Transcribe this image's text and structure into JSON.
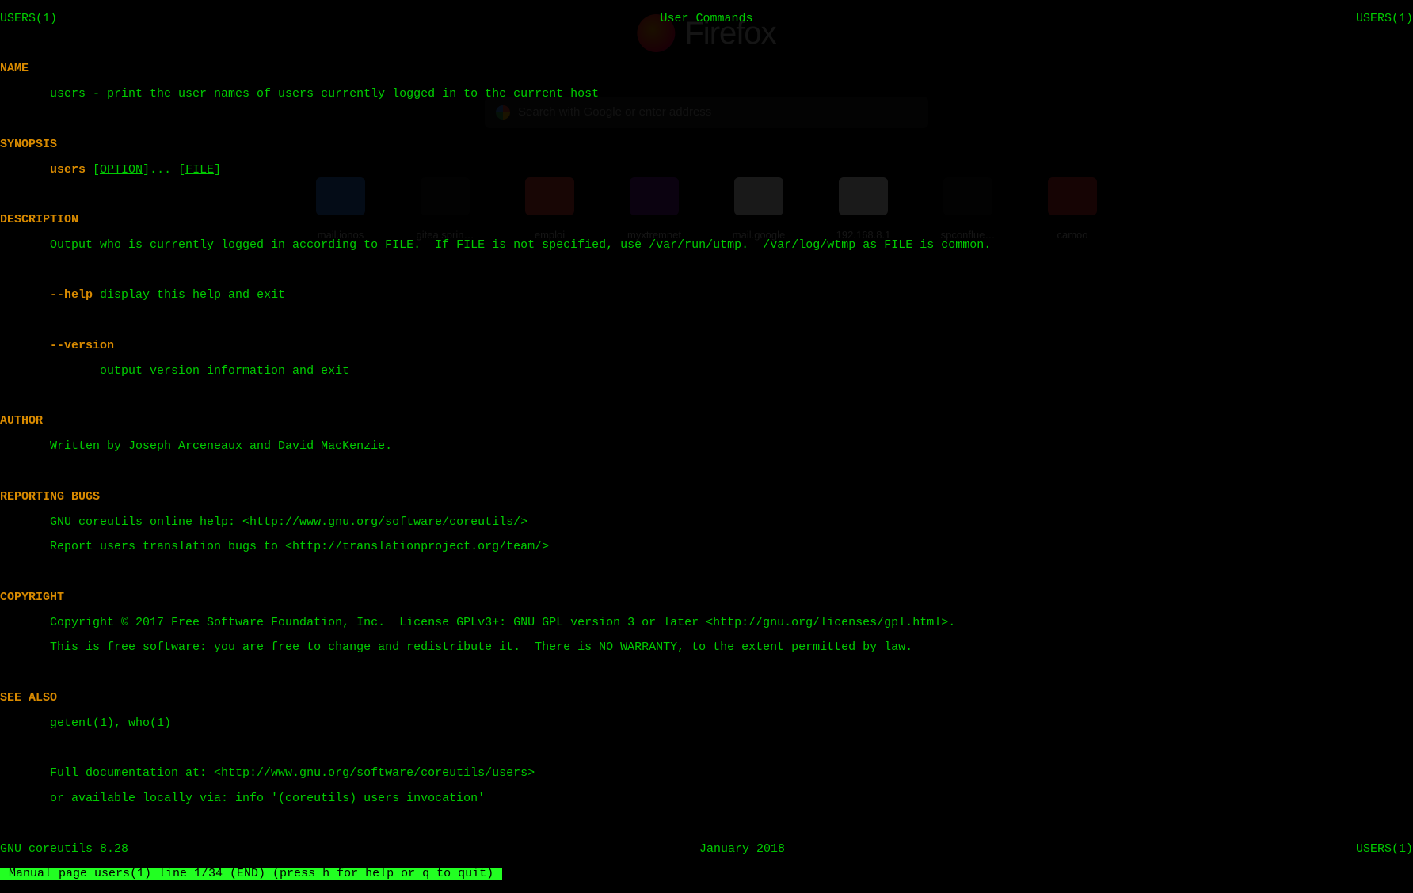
{
  "bg": {
    "logo_text": "Firefox",
    "search_placeholder": "Search with Google or enter address",
    "tiles": [
      {
        "label": "mail.ionos"
      },
      {
        "label": "gitea.sprin…"
      },
      {
        "label": "emploi"
      },
      {
        "label": "myxtremnet"
      },
      {
        "label": "mail.google"
      },
      {
        "label": "192.168.8.1"
      },
      {
        "label": "spconflue…"
      },
      {
        "label": "camoo"
      }
    ]
  },
  "header": {
    "left": "USERS(1)",
    "center": "User Commands",
    "right": "USERS(1)"
  },
  "footer_top": {
    "left": "GNU coreutils 8.28",
    "center": "January 2018",
    "right": "USERS(1)"
  },
  "footer_prompt": " Manual page users(1) line 1/34 (END) (press h for help or q to quit) ",
  "sec": {
    "name_h": "NAME",
    "name_t": "       users - print the user names of users currently logged in to the current host",
    "syn_h": "SYNOPSIS",
    "syn_pre": "       users",
    "syn_opt": "OPTION",
    "syn_mid": "]... [",
    "syn_file": "FILE",
    "syn_end": "]",
    "desc_h": "DESCRIPTION",
    "desc1_pre": "       Output who is currently logged in according to FILE.  If FILE is not specified, use ",
    "desc1_u1": "/var/run/utmp",
    "desc1_mid": ".  ",
    "desc1_u2": "/var/log/wtmp",
    "desc1_post": " as FILE is common.",
    "help_pre": "       ",
    "help_b": "--help",
    "help_t": " display this help and exit",
    "ver_pre": "       ",
    "ver_b": "--version",
    "ver_t": "              output version information and exit",
    "auth_h": "AUTHOR",
    "auth_t": "       Written by Joseph Arceneaux and David MacKenzie.",
    "bugs_h": "REPORTING BUGS",
    "bugs1": "       GNU coreutils online help: <http://www.gnu.org/software/coreutils/>",
    "bugs2": "       Report users translation bugs to <http://translationproject.org/team/>",
    "copy_h": "COPYRIGHT",
    "copy1": "       Copyright © 2017 Free Software Foundation, Inc.  License GPLv3+: GNU GPL version 3 or later <http://gnu.org/licenses/gpl.html>.",
    "copy2": "       This is free software: you are free to change and redistribute it.  There is NO WARRANTY, to the extent permitted by law.",
    "seealso_h": "SEE ALSO",
    "seealso1": "       getent(1), who(1)",
    "seealso2": "       Full documentation at: <http://www.gnu.org/software/coreutils/users>",
    "seealso3": "       or available locally via: info '(coreutils) users invocation'"
  }
}
